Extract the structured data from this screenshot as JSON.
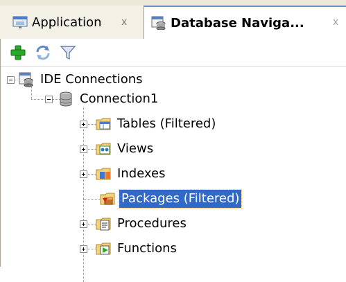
{
  "tabs": [
    {
      "label": "Application",
      "close": "x",
      "icon": "application-icon"
    },
    {
      "label": "Database Naviga...",
      "close": "x",
      "icon": "database-navigator-icon"
    }
  ],
  "toolbar": {
    "add_icon": "add-icon",
    "refresh_icon": "refresh-icon",
    "filter_icon": "filter-icon"
  },
  "tree": {
    "root": {
      "label": "IDE Connections",
      "icon": "ide-connections-icon"
    },
    "connection": {
      "label": "Connection1",
      "icon": "database-icon"
    },
    "items": [
      {
        "label": "Tables (Filtered)",
        "icon": "tables-icon"
      },
      {
        "label": "Views",
        "icon": "views-icon"
      },
      {
        "label": "Indexes",
        "icon": "indexes-icon"
      },
      {
        "label": "Packages (Filtered)",
        "icon": "packages-icon",
        "selected": true
      },
      {
        "label": "Procedures",
        "icon": "procedures-icon"
      },
      {
        "label": "Functions",
        "icon": "functions-icon"
      }
    ]
  },
  "colors": {
    "selection": "#3169c6",
    "tab_bar": "#ece9d8",
    "add_green": "#2aa82a"
  }
}
